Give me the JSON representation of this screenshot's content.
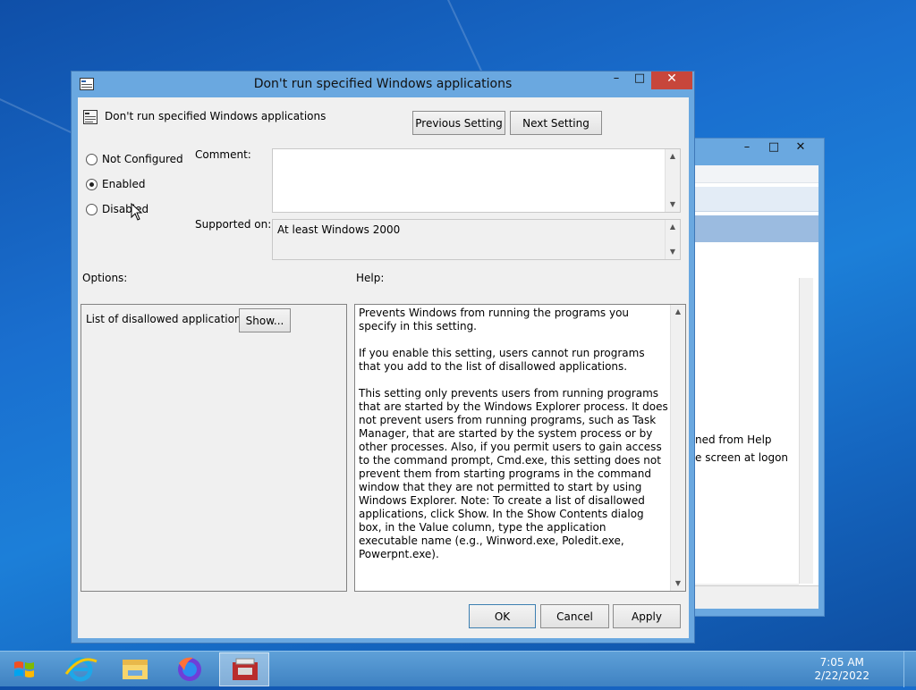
{
  "dialog": {
    "title": "Don't run specified Windows applications",
    "policy_title": "Don't run specified Windows applications",
    "buttons": {
      "previous": "Previous Setting",
      "next": "Next Setting",
      "ok": "OK",
      "cancel": "Cancel",
      "apply": "Apply",
      "show": "Show..."
    },
    "radios": [
      {
        "label": "Not Configured",
        "checked": false
      },
      {
        "label": "Enabled",
        "checked": true
      },
      {
        "label": "Disabled",
        "checked": false
      }
    ],
    "comment_label": "Comment:",
    "comment_value": "",
    "supported_label": "Supported on:",
    "supported_value": "At least Windows 2000",
    "options_label": "Options:",
    "help_label": "Help:",
    "options_item": "List of disallowed applications",
    "help_paragraphs": [
      "Prevents Windows from running the programs you specify in this setting.",
      "If you enable this setting, users cannot run programs that you add to the list of disallowed applications.",
      "This setting only prevents users from running programs that are started by the Windows Explorer process. It does not prevent users from running programs, such as Task Manager, that are started by the system process or by other processes. Also, if you permit users to gain access to the command prompt, Cmd.exe, this setting does not prevent them from starting programs in the command window that they are not permitted to start by using Windows Explorer. Note: To create a list of disallowed applications, click Show. In the Show Contents dialog box, in the Value column, type the application executable name (e.g., Winword.exe, Poledit.exe, Powerpnt.exe)."
    ]
  },
  "background_window": {
    "text_line1": "ned from Help",
    "text_line2": "e screen at logon"
  },
  "taskbar": {
    "time": "7:05 AM",
    "date": "2/22/2022",
    "items": [
      "start-button",
      "internet-explorer-icon",
      "file-explorer-icon",
      "firefox-icon",
      "group-policy-editor-icon"
    ]
  },
  "colors": {
    "title_bar": "#6aa8e0",
    "close_button": "#c7463b",
    "dialog_face": "#f0f0f0"
  }
}
